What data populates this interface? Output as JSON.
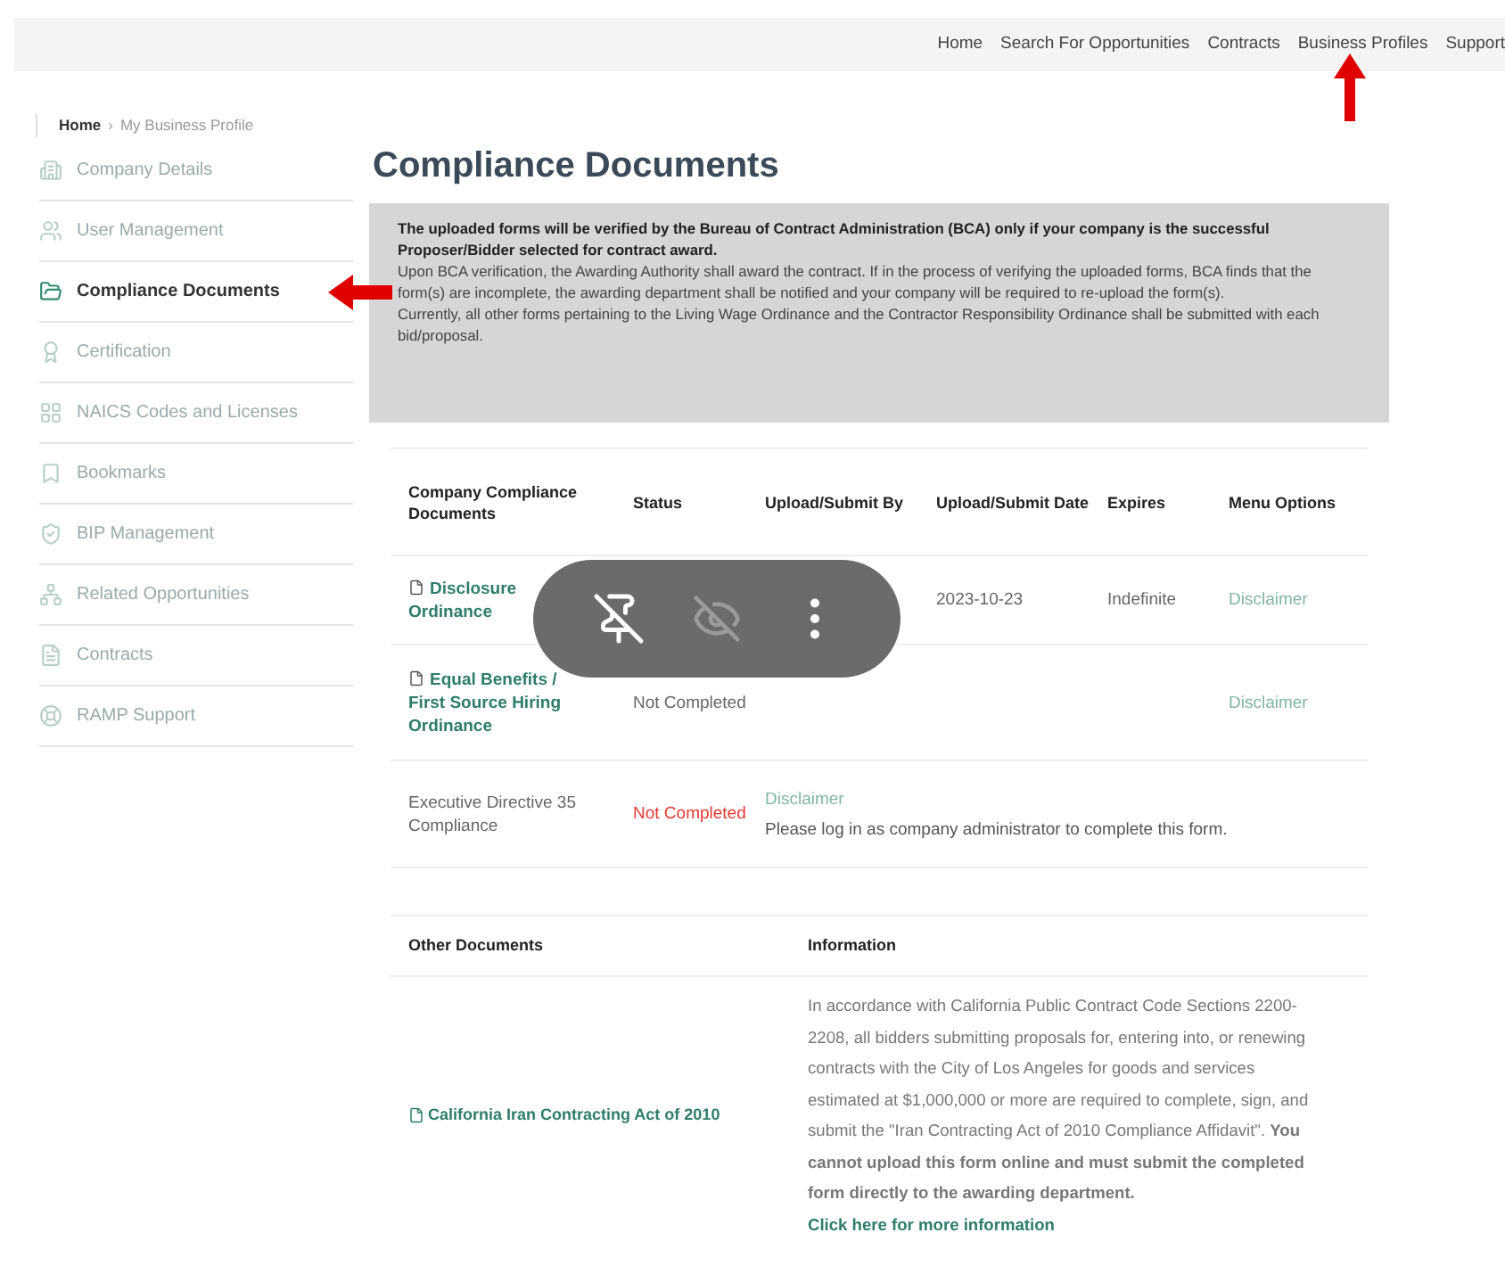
{
  "nav": {
    "items": [
      "Home",
      "Search For Opportunities",
      "Contracts",
      "Business Profiles",
      "Support"
    ]
  },
  "breadcrumb": {
    "home": "Home",
    "separator": "›",
    "current": "My Business Profile"
  },
  "sidebar": {
    "items": [
      {
        "label": "Company Details",
        "selected": false
      },
      {
        "label": "User Management",
        "selected": false
      },
      {
        "label": "Compliance Documents",
        "selected": true
      },
      {
        "label": "Certification",
        "selected": false
      },
      {
        "label": "NAICS Codes and Licenses",
        "selected": false
      },
      {
        "label": "Bookmarks",
        "selected": false
      },
      {
        "label": "BIP Management",
        "selected": false
      },
      {
        "label": "Related Opportunities",
        "selected": false
      },
      {
        "label": "Contracts",
        "selected": false
      },
      {
        "label": "RAMP Support",
        "selected": false
      }
    ]
  },
  "page_title": "Compliance Documents",
  "notice": [
    {
      "kind": "bold",
      "text": "The uploaded forms will be verified by the Bureau of Contract Administration (BCA) only if your company is the successful Proposer/Bidder selected for contract award."
    },
    {
      "kind": "plain",
      "text": "Upon BCA verification, the Awarding Authority shall award the contract. If in the process of verifying the uploaded forms, BCA finds that the form(s) are incomplete, the awarding department shall be notified and your company will be required to re-upload the form(s)."
    },
    {
      "kind": "plain",
      "text": "Currently, all other forms pertaining to the Living Wage Ordinance and the Contractor Responsibility Ordinance shall be submitted with each bid/proposal."
    }
  ],
  "documents_table": {
    "columns": [
      "Company Compliance Documents",
      "Status",
      "Upload/Submit By",
      "Upload/Submit Date",
      "Expires",
      "Menu Options"
    ],
    "rows": [
      {
        "kind": "standard",
        "document": {
          "text": "Disclosure Ordinance",
          "link": true
        },
        "date": "2023-10-23",
        "expires": "Indefinite",
        "menu": "Disclaimer"
      },
      {
        "kind": "standard",
        "document": {
          "text": "Equal Benefits / First Source Hiring Ordinance",
          "link": true
        },
        "status": {
          "text": "Not Completed",
          "alert": false
        },
        "menu": "Disclaimer"
      },
      {
        "kind": "note",
        "document": {
          "text": "Executive Directive 35 Compliance",
          "link": false
        },
        "status": {
          "text": "Not Completed",
          "alert": true
        },
        "menu": "Disclaimer",
        "note": "Please log in as company administrator to complete this form."
      }
    ]
  },
  "other_table": {
    "columns": [
      "Other Documents",
      "Information"
    ],
    "rows": [
      {
        "document": "California Iran Contracting Act of 2010",
        "information": "In accordance with California Public Contract Code Sections 2200-2208, all bidders submitting proposals for, entering into, or renewing contracts with the City of Los Angeles for goods and services estimated at $1,000,000 or more are required to complete, sign, and submit the \"Iran Contracting Act of 2010 Compliance Affidavit\". **You cannot upload this form online and must submit the completed form directly to the awarding department.**",
        "link": "Click here for more information"
      }
    ]
  }
}
